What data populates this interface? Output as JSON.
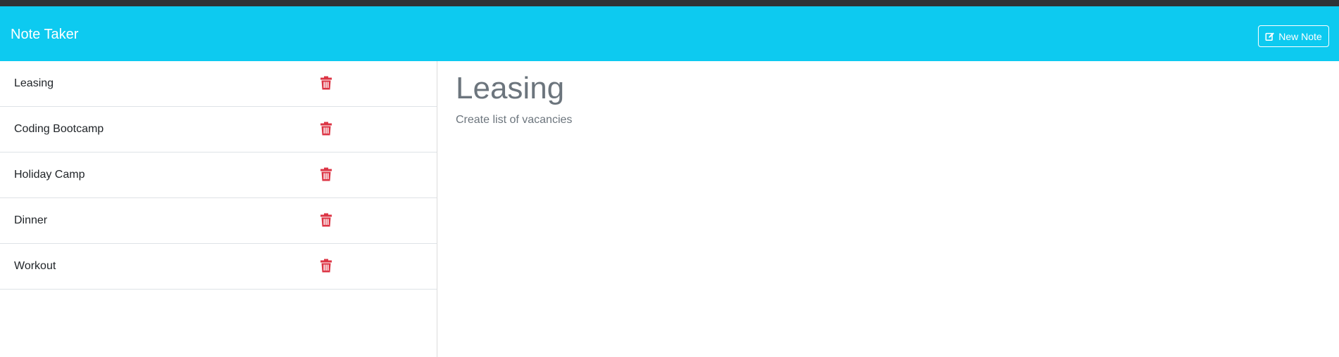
{
  "app": {
    "title": "Note Taker",
    "new_note_label": "New Note",
    "brand_color": "#0dcaf0",
    "delete_color": "#dc3545"
  },
  "notes": [
    {
      "title": "Leasing",
      "delete_icon": "trash-icon"
    },
    {
      "title": "Coding Bootcamp",
      "delete_icon": "trash-icon"
    },
    {
      "title": "Holiday Camp",
      "delete_icon": "trash-icon"
    },
    {
      "title": "Dinner",
      "delete_icon": "trash-icon"
    },
    {
      "title": "Workout",
      "delete_icon": "trash-icon"
    }
  ],
  "active_note": {
    "title": "Leasing",
    "text": "Create list of vacancies"
  }
}
